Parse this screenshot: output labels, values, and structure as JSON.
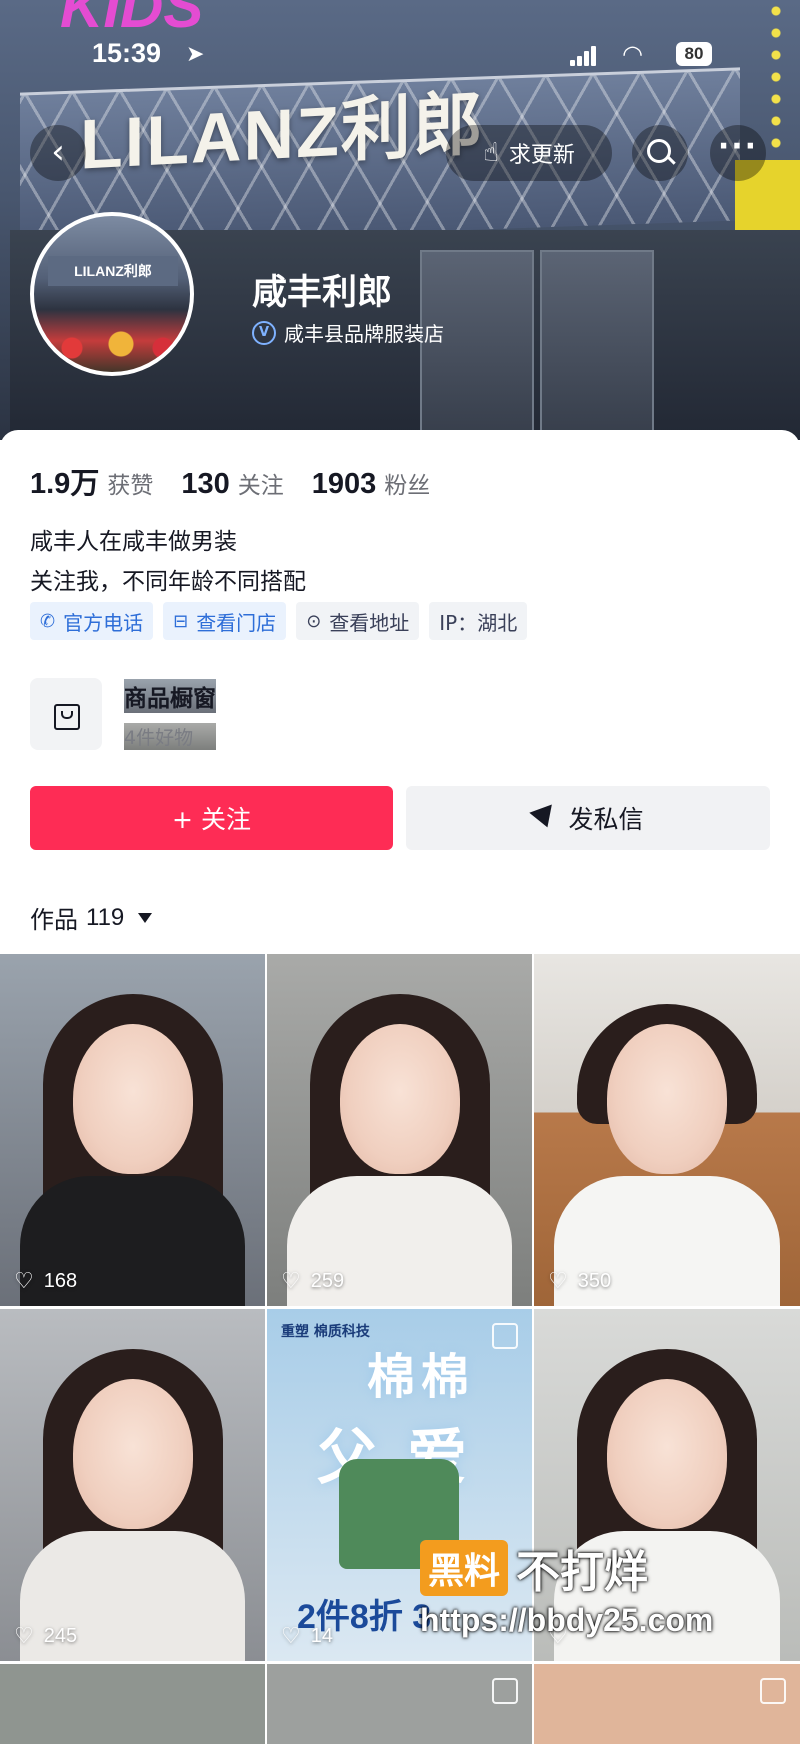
{
  "status_bar": {
    "time": "15:39",
    "battery": "80"
  },
  "banner": {
    "brand_text": "LILANZ利郎",
    "kids_text": "KIDS"
  },
  "nav": {
    "update_label": "求更新"
  },
  "profile": {
    "name": "咸丰利郎",
    "verified_label": "咸丰县品牌服装店",
    "avatar_sign": "LILANZ利郎"
  },
  "stats": [
    {
      "num": "1.9万",
      "label": "获赞"
    },
    {
      "num": "130",
      "label": "关注"
    },
    {
      "num": "1903",
      "label": "粉丝"
    }
  ],
  "bio": {
    "line1": "咸丰人在咸丰做男装",
    "line2": "关注我，不同年龄不同搭配"
  },
  "tags": [
    {
      "label": "官方电话",
      "icon": "phone-icon"
    },
    {
      "label": "查看门店",
      "icon": "store-icon"
    },
    {
      "label": "查看地址",
      "icon": "location-icon"
    },
    {
      "label": "IP：湖北"
    }
  ],
  "showcase": {
    "title": "商品橱窗",
    "subtitle": "4件好物"
  },
  "buttons": {
    "follow": "+ 关注",
    "message": "发私信"
  },
  "works": {
    "label": "作品",
    "count": "119"
  },
  "videos": [
    {
      "likes": "168"
    },
    {
      "likes": "259"
    },
    {
      "likes": "350"
    },
    {
      "likes": "245"
    },
    {
      "likes": "14",
      "poster_title": "棉棉",
      "poster_title2": "父爱",
      "poster_brand": "重塑\n棉质科技",
      "poster_discount": "2件8折 3"
    },
    {
      "likes": ""
    }
  ],
  "watermark": {
    "box": "黑料",
    "text": "不打烊",
    "url": "https://bbdy25.com"
  },
  "colors": {
    "accent": "#fe2c55",
    "tag_blue": "#2e6ed8"
  }
}
